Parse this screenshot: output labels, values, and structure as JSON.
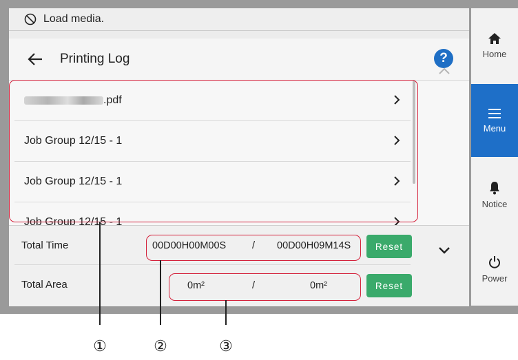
{
  "status_bar": {
    "icon": "no-media-icon",
    "message": "Load media."
  },
  "header": {
    "title": "Printing Log",
    "help_label": "?"
  },
  "log_list": {
    "items": [
      {
        "label": ".pdf",
        "redacted_prefix": true
      },
      {
        "label": "Job Group 12/15 - 1"
      },
      {
        "label": "Job Group 12/15 - 1"
      },
      {
        "label": "Job Group 12/15 - 1"
      }
    ]
  },
  "totals": {
    "time": {
      "label": "Total Time",
      "value_a": "00D00H00M00S",
      "separator": "/",
      "value_b": "00D00H09M14S",
      "reset_label": "Reset"
    },
    "area": {
      "label": "Total Area",
      "value_a": "0m²",
      "separator": "/",
      "value_b": "0m²",
      "reset_label": "Reset"
    }
  },
  "sidebar": {
    "items": [
      {
        "label": "Home",
        "icon": "home-icon"
      },
      {
        "label": "Menu",
        "icon": "menu-icon",
        "active": true
      },
      {
        "label": "Notice",
        "icon": "bell-icon"
      },
      {
        "label": "Power",
        "icon": "power-icon"
      }
    ]
  },
  "callouts": [
    "①",
    "②",
    "③"
  ],
  "colors": {
    "accent": "#1e6fc8",
    "reset": "#3aaa6b",
    "highlight": "#d4203a"
  }
}
